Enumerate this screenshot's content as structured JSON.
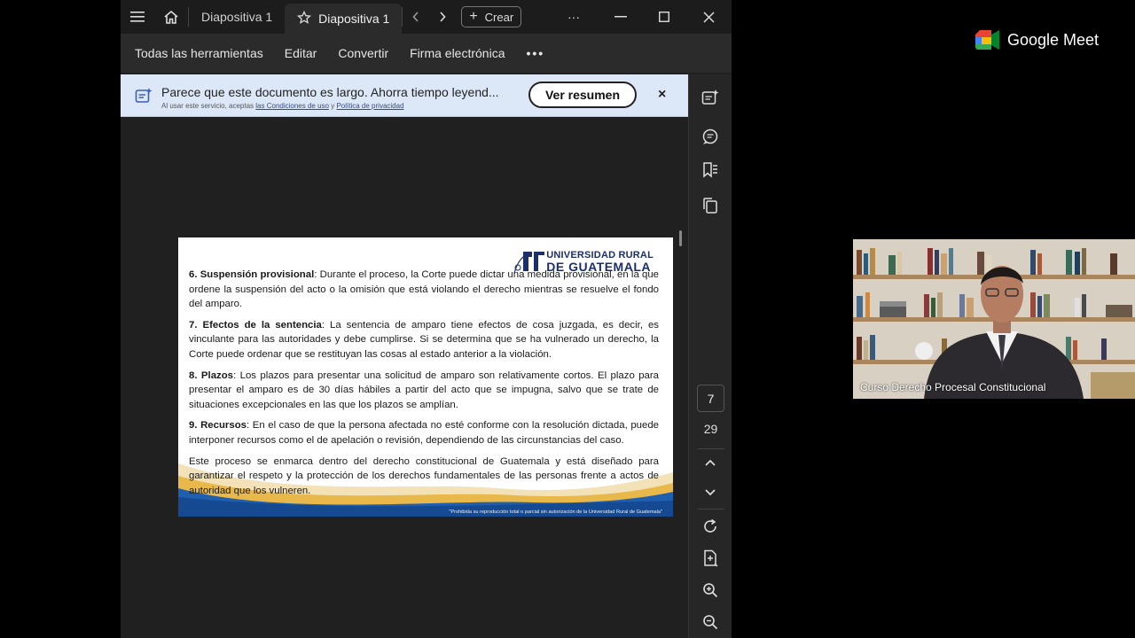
{
  "window": {
    "tabs": [
      {
        "label": "Diapositiva 1",
        "active": false
      },
      {
        "label": "Diapositiva 1",
        "active": true
      }
    ],
    "create_label": "Crear",
    "more_label": "···"
  },
  "toolbar": {
    "items": [
      "Todas las herramientas",
      "Editar",
      "Convertir",
      "Firma electrónica"
    ],
    "more": "•••"
  },
  "banner": {
    "title": "Parece que este documento es largo. Ahorra tiempo leyend...",
    "sub_prefix": "Al usar este servicio, aceptas",
    "terms_link": "las Condiciones de uso",
    "sub_and": "y",
    "privacy_link": "Política de privacidad",
    "button": "Ver resumen",
    "close": "×"
  },
  "pager": {
    "current": "7",
    "total": "29"
  },
  "slide": {
    "logo_line1": "UNIVERSIDAD RURAL",
    "logo_line2": "DE GUATEMALA",
    "p6_head": "6. Suspensión provisional",
    "p6_body": ": Durante el proceso, la Corte puede dictar una medida provisional, en la que ordene la suspensión del acto o la omisión que está violando el derecho mientras se resuelve el fondo del amparo.",
    "p7_head": "7. Efectos de la sentencia",
    "p7_body": ": La sentencia de amparo tiene efectos de cosa juzgada, es decir, es vinculante para las autoridades y debe cumplirse. Si se determina que se ha vulnerado un derecho, la Corte puede ordenar que se restituyan las cosas al estado anterior a la violación.",
    "p8_head": "8. Plazos",
    "p8_body": ": Los plazos para presentar una solicitud de amparo son relativamente cortos. El plazo para presentar el amparo es de 30 días hábiles a partir del acto que se impugna, salvo que se trate de situaciones excepcionales en las que los plazos se amplían.",
    "p9_head": "9. Recursos",
    "p9_body": ": En el caso de que la persona afectada no esté conforme con la resolución dictada, puede interponer recursos como el de apelación o revisión, dependiendo de las circunstancias del caso.",
    "closing": "Este proceso se enmarca dentro del derecho constitucional de Guatemala y está diseñado para garantizar el respeto y la protección de los derechos fundamentales de las personas frente a actos de autoridad que los vulneren.",
    "footer": "\"Prohibida su reproducción total o parcial sin autorización de la Universidad Rural de Guatemala\""
  },
  "meet": {
    "brand": "Google Meet",
    "participant_caption": "Curso Derecho Procesal Constitucional"
  },
  "colors": {
    "banner_bg": "#dce8f8",
    "logo_blue": "#1b2f6b",
    "wave_gold": "#e8b84a",
    "wave_blue": "#1e5fb0"
  }
}
